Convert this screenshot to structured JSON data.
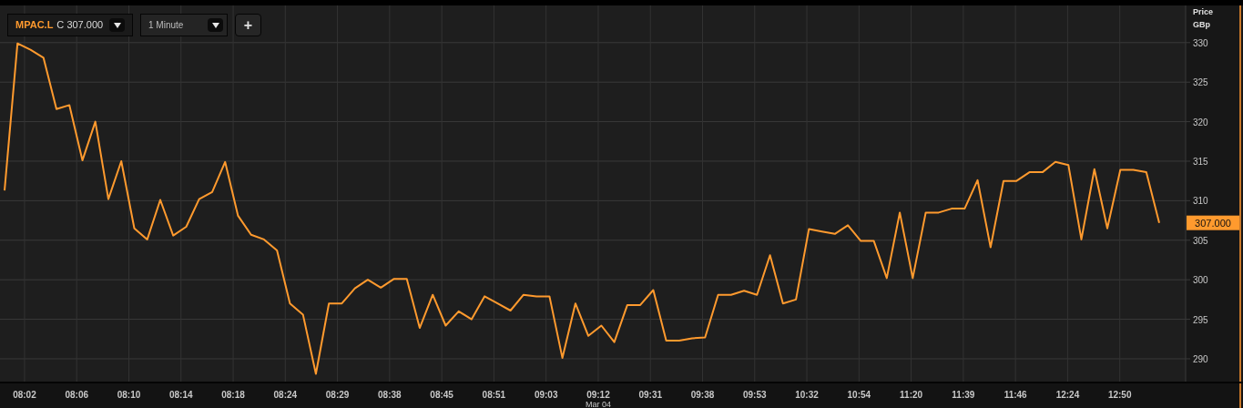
{
  "toolbar": {
    "symbol": "MPAC.L",
    "price_prefix": "C",
    "price": "307.000",
    "interval": "1 Minute",
    "add_button": "+"
  },
  "chart": {
    "unit": "GBp",
    "last_price_label": "307.000",
    "date_label": "Mar 04",
    "time_labels": [
      "08:02",
      "08:06",
      "08:10",
      "08:14",
      "08:18",
      "08:24",
      "08:29",
      "08:38",
      "08:45",
      "08:51",
      "09:03",
      "09:12",
      "09:31",
      "09:38",
      "09:53",
      "10:32",
      "10:54",
      "11:20",
      "11:39",
      "11:46",
      "12:24",
      "12:50"
    ],
    "chart_data": {
      "type": "line",
      "ylabel": "Price",
      "grid": true,
      "ylim": [
        287,
        334.7
      ],
      "yticks": [
        290,
        295,
        300,
        305,
        310,
        315,
        320,
        325,
        330
      ],
      "series": [
        {
          "color": "#ff9a2e",
          "values": [
            311.3,
            329.9,
            329.1,
            328.1,
            321.6,
            322.1,
            315.1,
            320.0,
            310.2,
            315.0,
            306.5,
            305.1,
            310.1,
            305.6,
            306.7,
            310.2,
            311.1,
            314.9,
            308.1,
            305.7,
            305.1,
            303.7,
            297.0,
            295.6,
            288.1,
            297.0,
            297.0,
            298.9,
            300.0,
            299.0,
            300.1,
            300.1,
            293.9,
            298.1,
            294.2,
            296.0,
            295.0,
            297.9,
            297.0,
            296.1,
            298.1,
            297.9,
            297.9,
            290.1,
            297.0,
            292.9,
            294.2,
            292.1,
            296.8,
            296.8,
            298.7,
            292.3,
            292.3,
            292.6,
            292.7,
            298.1,
            298.1,
            298.6,
            298.1,
            303.1,
            297.0,
            297.5,
            306.4,
            306.1,
            305.8,
            306.9,
            304.9,
            304.9,
            300.2,
            308.5,
            300.2,
            308.5,
            308.5,
            309.0,
            309.0,
            312.6,
            304.1,
            312.5,
            312.5,
            313.6,
            313.6,
            314.9,
            314.5,
            305.1,
            314.0,
            306.5,
            313.9,
            313.9,
            313.6,
            307.2
          ]
        }
      ]
    }
  }
}
